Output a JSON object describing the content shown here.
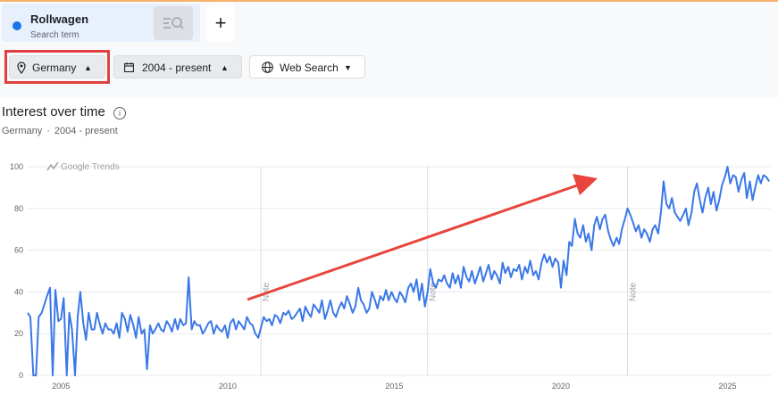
{
  "header": {
    "term": {
      "name": "Rollwagen",
      "sub": "Search term",
      "color": "#1a73e8"
    },
    "add_label": "+"
  },
  "filters": {
    "country": "Germany",
    "time": "2004 - present",
    "property": "Web Search"
  },
  "section": {
    "title": "Interest over time",
    "sub_country": "Germany",
    "sub_sep": "·",
    "sub_time": "2004 - present"
  },
  "watermark": "Google Trends",
  "annotation_label": "Note",
  "colors": {
    "line": "#3b78e7",
    "arrow": "#e8453c",
    "highlight": "#e04040"
  },
  "chart_data": {
    "type": "line",
    "ylim": [
      0,
      100
    ],
    "yticks": [
      0,
      20,
      40,
      60,
      80,
      100
    ],
    "xticks": [
      2005,
      2010,
      2015,
      2020,
      2025
    ],
    "xlim": [
      2004.0,
      2026.3
    ],
    "grid": true,
    "notes_at": [
      2011.0,
      2016.0,
      2022.0
    ],
    "series": [
      {
        "values": [
          [
            2004.0,
            30
          ],
          [
            2004.08,
            28
          ],
          [
            2004.17,
            0
          ],
          [
            2004.25,
            0
          ],
          [
            2004.33,
            28
          ],
          [
            2004.42,
            30
          ],
          [
            2004.5,
            34
          ],
          [
            2004.58,
            38
          ],
          [
            2004.67,
            42
          ],
          [
            2004.75,
            0
          ],
          [
            2004.83,
            41
          ],
          [
            2004.92,
            26
          ],
          [
            2005.0,
            27
          ],
          [
            2005.08,
            37
          ],
          [
            2005.17,
            0
          ],
          [
            2005.25,
            30
          ],
          [
            2005.33,
            22
          ],
          [
            2005.42,
            0
          ],
          [
            2005.5,
            28
          ],
          [
            2005.58,
            40
          ],
          [
            2005.67,
            25
          ],
          [
            2005.75,
            17
          ],
          [
            2005.83,
            30
          ],
          [
            2005.92,
            22
          ],
          [
            2006.0,
            22
          ],
          [
            2006.08,
            30
          ],
          [
            2006.17,
            24
          ],
          [
            2006.25,
            20
          ],
          [
            2006.33,
            25
          ],
          [
            2006.42,
            22
          ],
          [
            2006.5,
            22
          ],
          [
            2006.58,
            20
          ],
          [
            2006.67,
            25
          ],
          [
            2006.75,
            18
          ],
          [
            2006.83,
            30
          ],
          [
            2006.92,
            27
          ],
          [
            2007.0,
            21
          ],
          [
            2007.08,
            29
          ],
          [
            2007.17,
            24
          ],
          [
            2007.25,
            18
          ],
          [
            2007.33,
            28
          ],
          [
            2007.42,
            20
          ],
          [
            2007.5,
            22
          ],
          [
            2007.58,
            3
          ],
          [
            2007.67,
            24
          ],
          [
            2007.75,
            20
          ],
          [
            2007.83,
            22
          ],
          [
            2007.92,
            25
          ],
          [
            2008.0,
            22
          ],
          [
            2008.08,
            21
          ],
          [
            2008.17,
            26
          ],
          [
            2008.25,
            24
          ],
          [
            2008.33,
            21
          ],
          [
            2008.42,
            27
          ],
          [
            2008.5,
            22
          ],
          [
            2008.58,
            27
          ],
          [
            2008.67,
            24
          ],
          [
            2008.75,
            25
          ],
          [
            2008.83,
            47
          ],
          [
            2008.92,
            22
          ],
          [
            2009.0,
            26
          ],
          [
            2009.08,
            24
          ],
          [
            2009.17,
            24
          ],
          [
            2009.25,
            20
          ],
          [
            2009.33,
            22
          ],
          [
            2009.42,
            25
          ],
          [
            2009.5,
            26
          ],
          [
            2009.58,
            20
          ],
          [
            2009.67,
            24
          ],
          [
            2009.75,
            22
          ],
          [
            2009.83,
            21
          ],
          [
            2009.92,
            24
          ],
          [
            2010.0,
            18
          ],
          [
            2010.08,
            25
          ],
          [
            2010.17,
            27
          ],
          [
            2010.25,
            22
          ],
          [
            2010.33,
            26
          ],
          [
            2010.42,
            24
          ],
          [
            2010.5,
            22
          ],
          [
            2010.58,
            28
          ],
          [
            2010.67,
            25
          ],
          [
            2010.75,
            24
          ],
          [
            2010.83,
            20
          ],
          [
            2010.92,
            18
          ],
          [
            2011.0,
            23
          ],
          [
            2011.08,
            28
          ],
          [
            2011.17,
            26
          ],
          [
            2011.25,
            27
          ],
          [
            2011.33,
            24
          ],
          [
            2011.42,
            29
          ],
          [
            2011.5,
            28
          ],
          [
            2011.58,
            25
          ],
          [
            2011.67,
            30
          ],
          [
            2011.75,
            29
          ],
          [
            2011.83,
            31
          ],
          [
            2011.92,
            27
          ],
          [
            2012.0,
            28
          ],
          [
            2012.08,
            30
          ],
          [
            2012.17,
            32
          ],
          [
            2012.25,
            26
          ],
          [
            2012.33,
            33
          ],
          [
            2012.42,
            30
          ],
          [
            2012.5,
            28
          ],
          [
            2012.58,
            34
          ],
          [
            2012.67,
            32
          ],
          [
            2012.75,
            30
          ],
          [
            2012.83,
            36
          ],
          [
            2012.92,
            27
          ],
          [
            2013.0,
            31
          ],
          [
            2013.08,
            36
          ],
          [
            2013.17,
            30
          ],
          [
            2013.25,
            28
          ],
          [
            2013.33,
            32
          ],
          [
            2013.42,
            35
          ],
          [
            2013.5,
            32
          ],
          [
            2013.58,
            38
          ],
          [
            2013.67,
            34
          ],
          [
            2013.75,
            30
          ],
          [
            2013.83,
            33
          ],
          [
            2013.92,
            42
          ],
          [
            2014.0,
            36
          ],
          [
            2014.08,
            34
          ],
          [
            2014.17,
            30
          ],
          [
            2014.25,
            32
          ],
          [
            2014.33,
            40
          ],
          [
            2014.42,
            36
          ],
          [
            2014.5,
            32
          ],
          [
            2014.58,
            38
          ],
          [
            2014.67,
            36
          ],
          [
            2014.75,
            41
          ],
          [
            2014.83,
            36
          ],
          [
            2014.92,
            40
          ],
          [
            2015.0,
            37
          ],
          [
            2015.08,
            35
          ],
          [
            2015.17,
            40
          ],
          [
            2015.25,
            38
          ],
          [
            2015.33,
            35
          ],
          [
            2015.42,
            42
          ],
          [
            2015.5,
            44
          ],
          [
            2015.58,
            40
          ],
          [
            2015.67,
            46
          ],
          [
            2015.75,
            36
          ],
          [
            2015.83,
            44
          ],
          [
            2015.92,
            33
          ],
          [
            2016.0,
            40
          ],
          [
            2016.08,
            51
          ],
          [
            2016.17,
            44
          ],
          [
            2016.25,
            42
          ],
          [
            2016.33,
            46
          ],
          [
            2016.42,
            45
          ],
          [
            2016.5,
            48
          ],
          [
            2016.58,
            44
          ],
          [
            2016.67,
            42
          ],
          [
            2016.75,
            49
          ],
          [
            2016.83,
            44
          ],
          [
            2016.92,
            48
          ],
          [
            2017.0,
            42
          ],
          [
            2017.08,
            52
          ],
          [
            2017.17,
            47
          ],
          [
            2017.25,
            45
          ],
          [
            2017.33,
            50
          ],
          [
            2017.42,
            44
          ],
          [
            2017.5,
            48
          ],
          [
            2017.58,
            52
          ],
          [
            2017.67,
            45
          ],
          [
            2017.75,
            49
          ],
          [
            2017.83,
            53
          ],
          [
            2017.92,
            46
          ],
          [
            2018.0,
            50
          ],
          [
            2018.08,
            48
          ],
          [
            2018.17,
            44
          ],
          [
            2018.25,
            54
          ],
          [
            2018.33,
            49
          ],
          [
            2018.42,
            52
          ],
          [
            2018.5,
            47
          ],
          [
            2018.58,
            51
          ],
          [
            2018.67,
            50
          ],
          [
            2018.75,
            53
          ],
          [
            2018.83,
            46
          ],
          [
            2018.92,
            52
          ],
          [
            2019.0,
            49
          ],
          [
            2019.08,
            55
          ],
          [
            2019.17,
            48
          ],
          [
            2019.25,
            50
          ],
          [
            2019.33,
            46
          ],
          [
            2019.42,
            54
          ],
          [
            2019.5,
            58
          ],
          [
            2019.58,
            54
          ],
          [
            2019.67,
            57
          ],
          [
            2019.75,
            52
          ],
          [
            2019.83,
            56
          ],
          [
            2019.92,
            54
          ],
          [
            2020.0,
            42
          ],
          [
            2020.08,
            55
          ],
          [
            2020.17,
            48
          ],
          [
            2020.25,
            64
          ],
          [
            2020.33,
            62
          ],
          [
            2020.42,
            75
          ],
          [
            2020.5,
            68
          ],
          [
            2020.58,
            66
          ],
          [
            2020.67,
            72
          ],
          [
            2020.75,
            64
          ],
          [
            2020.83,
            68
          ],
          [
            2020.92,
            60
          ],
          [
            2021.0,
            72
          ],
          [
            2021.08,
            76
          ],
          [
            2021.17,
            70
          ],
          [
            2021.25,
            75
          ],
          [
            2021.33,
            77
          ],
          [
            2021.42,
            69
          ],
          [
            2021.5,
            65
          ],
          [
            2021.58,
            62
          ],
          [
            2021.67,
            66
          ],
          [
            2021.75,
            63
          ],
          [
            2021.83,
            70
          ],
          [
            2021.92,
            75
          ],
          [
            2022.0,
            80
          ],
          [
            2022.08,
            77
          ],
          [
            2022.17,
            73
          ],
          [
            2022.25,
            69
          ],
          [
            2022.33,
            72
          ],
          [
            2022.42,
            66
          ],
          [
            2022.5,
            70
          ],
          [
            2022.58,
            68
          ],
          [
            2022.67,
            64
          ],
          [
            2022.75,
            70
          ],
          [
            2022.83,
            72
          ],
          [
            2022.92,
            68
          ],
          [
            2023.0,
            78
          ],
          [
            2023.08,
            93
          ],
          [
            2023.17,
            82
          ],
          [
            2023.25,
            80
          ],
          [
            2023.33,
            85
          ],
          [
            2023.42,
            78
          ],
          [
            2023.5,
            76
          ],
          [
            2023.58,
            74
          ],
          [
            2023.67,
            77
          ],
          [
            2023.75,
            80
          ],
          [
            2023.83,
            72
          ],
          [
            2023.92,
            78
          ],
          [
            2024.0,
            88
          ],
          [
            2024.08,
            92
          ],
          [
            2024.17,
            84
          ],
          [
            2024.25,
            78
          ],
          [
            2024.33,
            85
          ],
          [
            2024.42,
            90
          ],
          [
            2024.5,
            82
          ],
          [
            2024.58,
            88
          ],
          [
            2024.67,
            79
          ],
          [
            2024.75,
            84
          ],
          [
            2024.83,
            91
          ],
          [
            2024.92,
            95
          ],
          [
            2025.0,
            100
          ],
          [
            2025.08,
            92
          ],
          [
            2025.17,
            96
          ],
          [
            2025.25,
            95
          ],
          [
            2025.33,
            88
          ],
          [
            2025.42,
            94
          ],
          [
            2025.5,
            97
          ],
          [
            2025.58,
            85
          ],
          [
            2025.67,
            93
          ],
          [
            2025.75,
            84
          ],
          [
            2025.83,
            90
          ],
          [
            2025.92,
            96
          ],
          [
            2026.0,
            92
          ],
          [
            2026.08,
            96
          ],
          [
            2026.17,
            95
          ],
          [
            2026.25,
            93
          ]
        ]
      }
    ]
  }
}
